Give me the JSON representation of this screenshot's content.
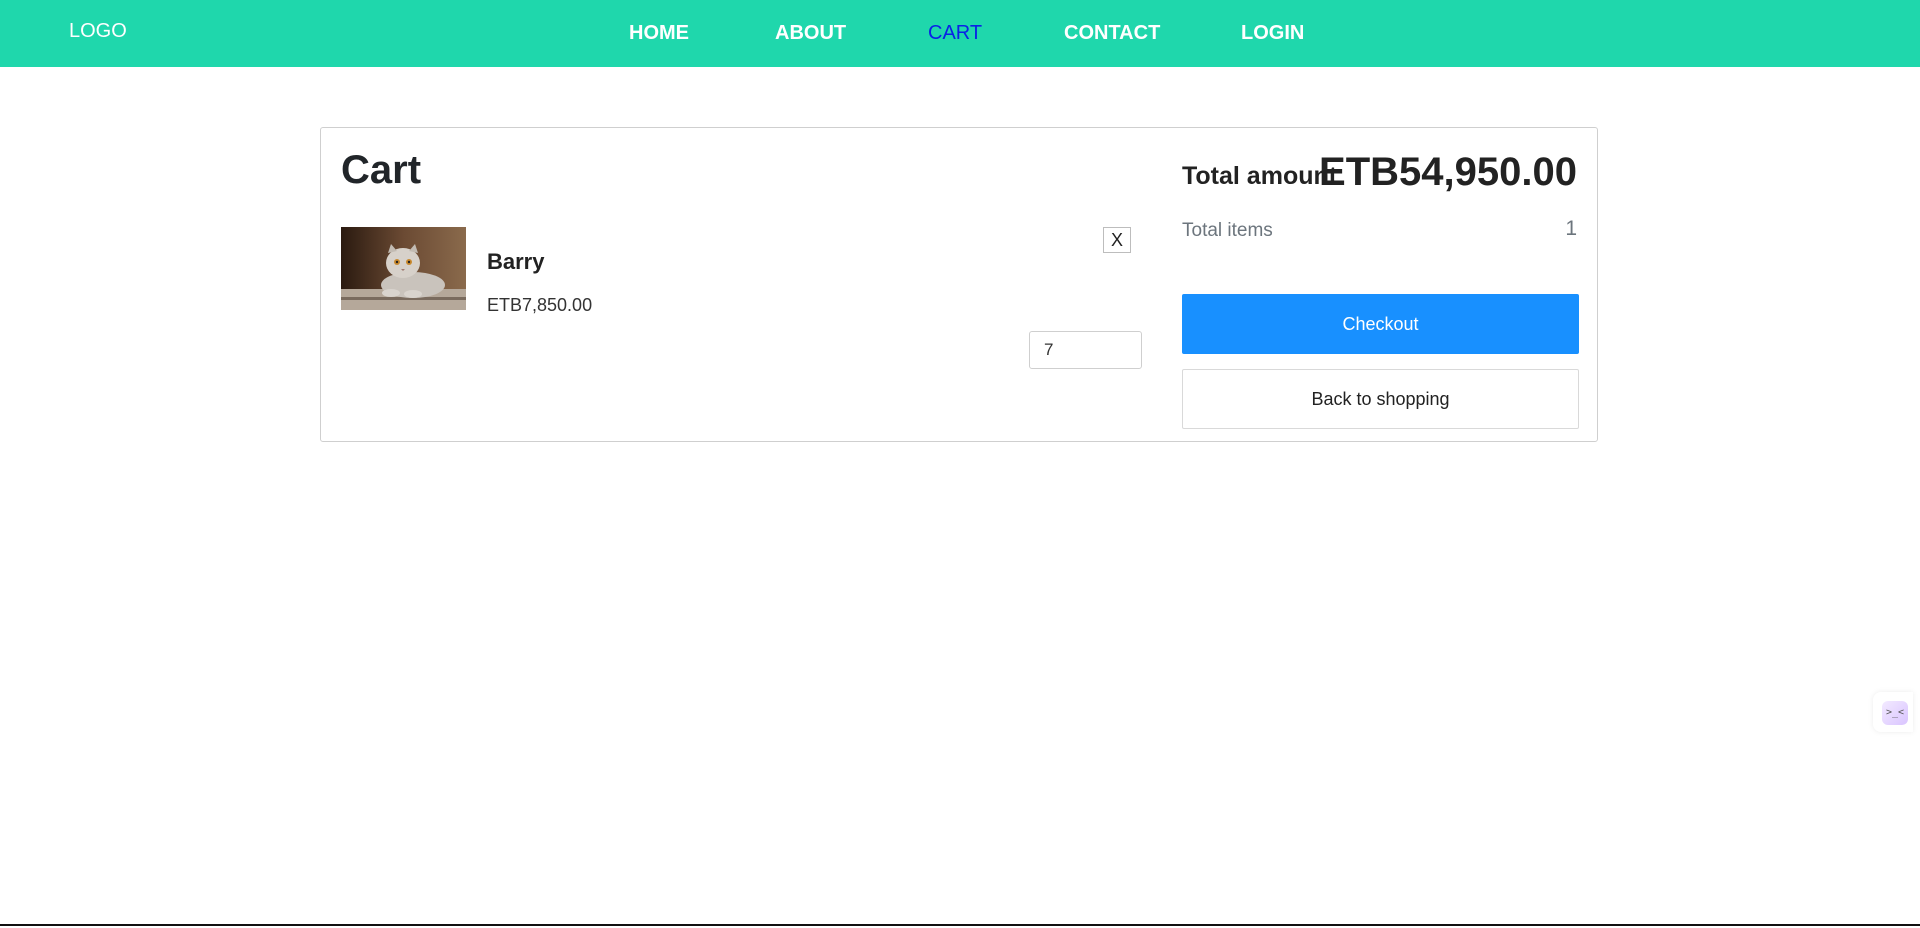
{
  "header": {
    "logo": "LOGO",
    "nav": [
      {
        "label": "HOME",
        "active": false
      },
      {
        "label": "ABOUT",
        "active": false
      },
      {
        "label": "CART",
        "active": true
      },
      {
        "label": "CONTACT",
        "active": false
      },
      {
        "label": "LOGIN",
        "active": false
      }
    ]
  },
  "cart": {
    "title": "Cart",
    "items": [
      {
        "name": "Barry",
        "price": "ETB7,850.00",
        "quantity": "7",
        "remove_label": "X",
        "image": "cat-photo"
      }
    ]
  },
  "summary": {
    "total_amount_label": "Total amount",
    "total_amount_value": "ETB54,950.00",
    "total_items_label": "Total items",
    "total_items_value": "1",
    "checkout_label": "Checkout",
    "back_label": "Back to shopping"
  },
  "widget": {
    "icon": "assistant-face-icon",
    "glyph": ">_<"
  },
  "colors": {
    "header_bg": "#1fd7ac",
    "nav_active": "#0a21e6",
    "checkout_bg": "#1890ff"
  }
}
